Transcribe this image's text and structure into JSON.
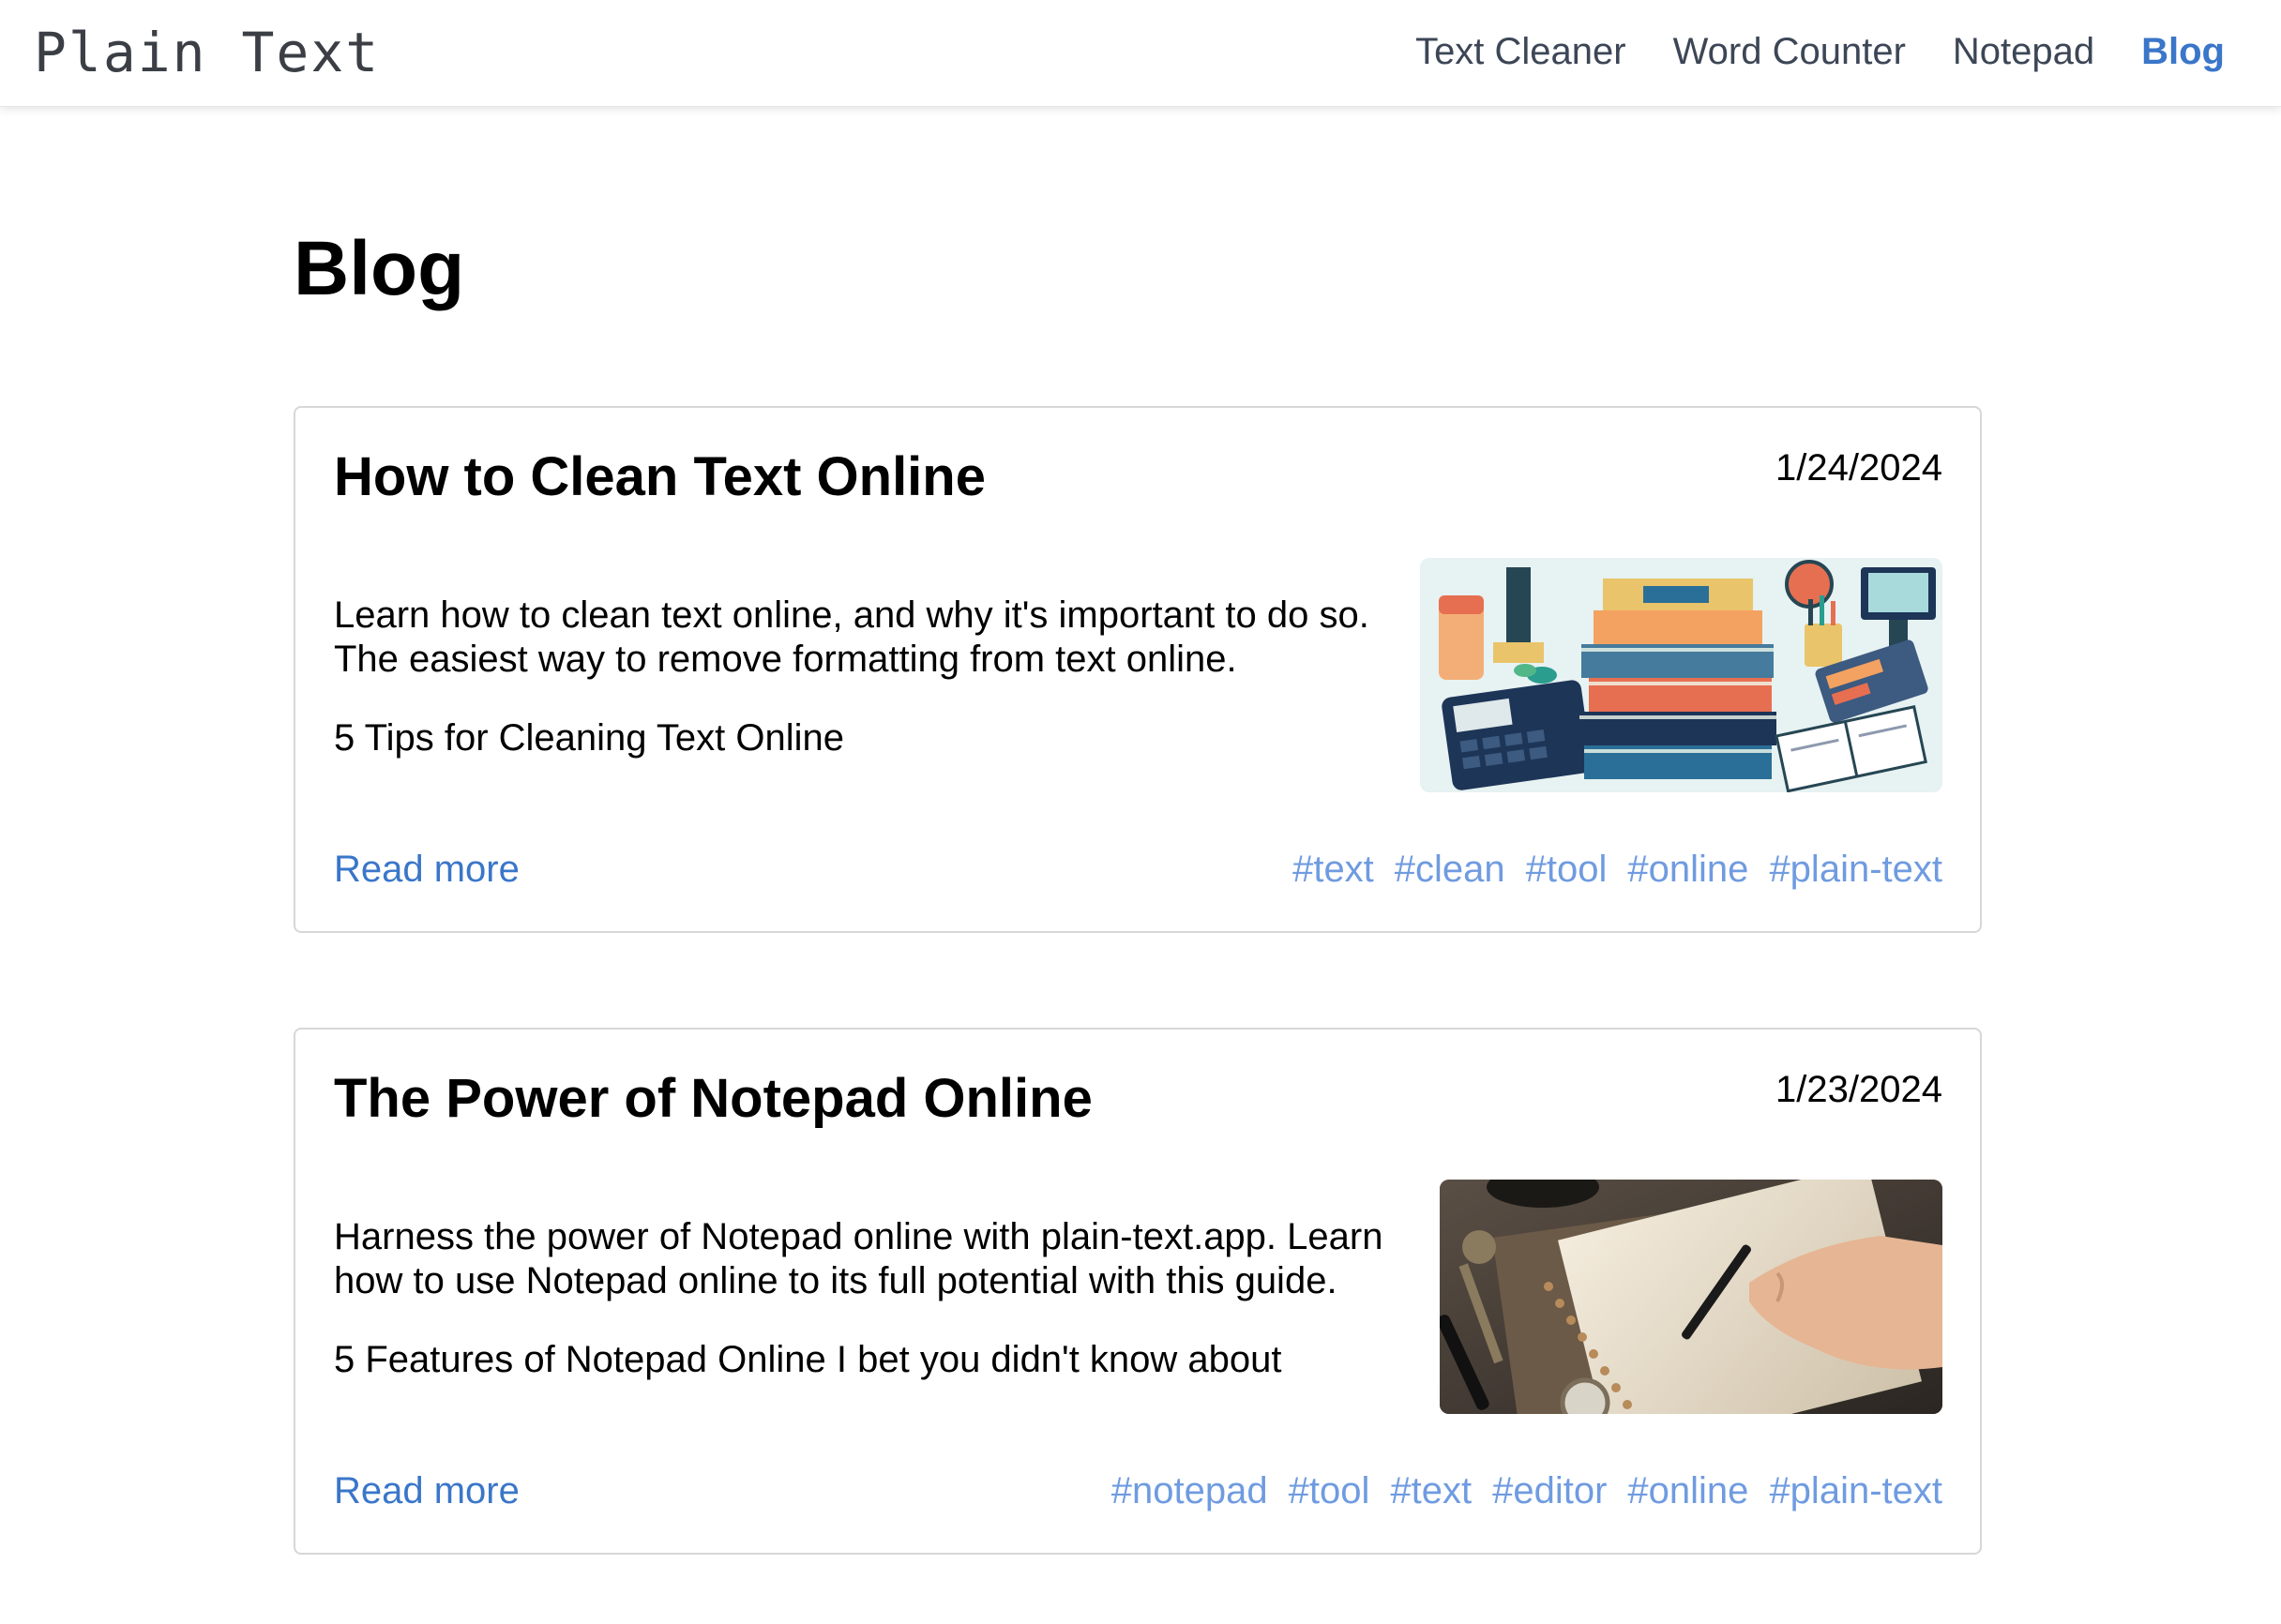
{
  "header": {
    "logo": "Plain Text",
    "nav": [
      {
        "label": "Text Cleaner"
      },
      {
        "label": "Word Counter"
      },
      {
        "label": "Notepad"
      },
      {
        "label": "Blog"
      }
    ],
    "active": "Blog",
    "accent": "#3a76c9"
  },
  "page": {
    "title": "Blog"
  },
  "posts": [
    {
      "title": "How to Clean Text Online",
      "date": "1/24/2024",
      "summary": "Learn how to clean text online, and why it's important to do so. The easiest way to remove formatting from text online.",
      "subtitle": "5 Tips for Cleaning Text Online",
      "read_more": "Read more",
      "tags": [
        "#text",
        "#clean",
        "#tool",
        "#online",
        "#plain-text"
      ],
      "image": "books-illustration"
    },
    {
      "title": "The Power of Notepad Online",
      "date": "1/23/2024",
      "summary": "Harness the power of Notepad online with plain-text.app. Learn how to use Notepad online to its full potential with this guide.",
      "subtitle": "5 Features of Notepad Online I bet you didn't know about",
      "read_more": "Read more",
      "tags": [
        "#notepad",
        "#tool",
        "#text",
        "#editor",
        "#online",
        "#plain-text"
      ],
      "image": "handwriting-notebook-photo"
    }
  ]
}
